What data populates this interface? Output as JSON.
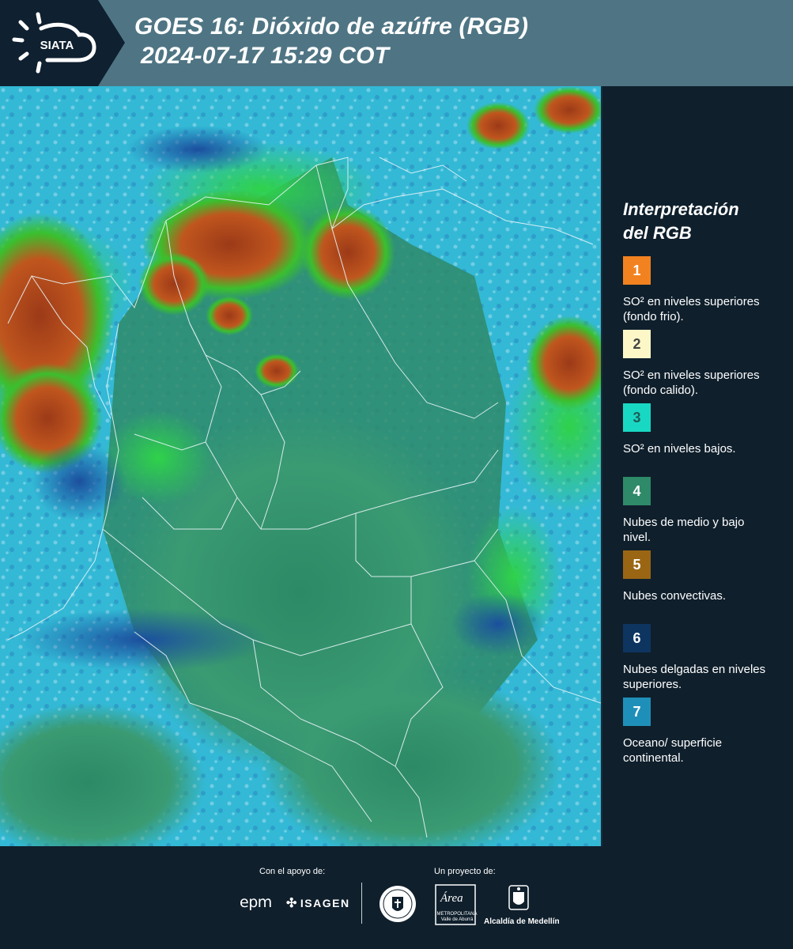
{
  "header": {
    "brand": "SIATA",
    "title_line1": "GOES 16: Dióxido de azúfre (RGB)",
    "title_line2": "2024-07-17 15:29 COT"
  },
  "legend": {
    "title_line1": "Interpretación",
    "title_line2": "del RGB",
    "items": [
      {
        "number": "1",
        "color": "#f28220",
        "text_color": "#ffffff",
        "label": "SO² en niveles superiores (fondo frio)."
      },
      {
        "number": "2",
        "color": "#fdf7c8",
        "text_color": "#444444",
        "label": "SO² en niveles superiores (fondo calido)."
      },
      {
        "number": "3",
        "color": "#19d8c3",
        "text_color": "#1d5e58",
        "label": "SO² en niveles bajos."
      },
      {
        "number": "4",
        "color": "#2e8a68",
        "text_color": "#ffffff",
        "label": "Nubes de medio y bajo nivel."
      },
      {
        "number": "5",
        "color": "#9a6614",
        "text_color": "#ffffff",
        "label": "Nubes convectivas."
      },
      {
        "number": "6",
        "color": "#0d3560",
        "text_color": "#ffffff",
        "label": "Nubes delgadas en niveles superiores."
      },
      {
        "number": "7",
        "color": "#1e8fb8",
        "text_color": "#ffffff",
        "label": "Oceano/ superficie continental."
      }
    ]
  },
  "footer": {
    "support_label": "Con el apoyo de:",
    "project_label": "Un proyecto de:",
    "sponsor_epm": "epm",
    "sponsor_isagen": "ISAGEN",
    "area_word": "Área",
    "area_sub": "METROPOLITANA Valle de Aburrá",
    "alcaldia": "Alcaldía de Medellín"
  },
  "colors": {
    "header_bg": "#4f7584",
    "logo_bg": "#0f2030",
    "page_bg": "#0f1f2c",
    "ocean": "#33b9d6",
    "land_cloud": "#2f8a68",
    "convective": "#b8441e",
    "boundary": "#e8f4f8"
  }
}
